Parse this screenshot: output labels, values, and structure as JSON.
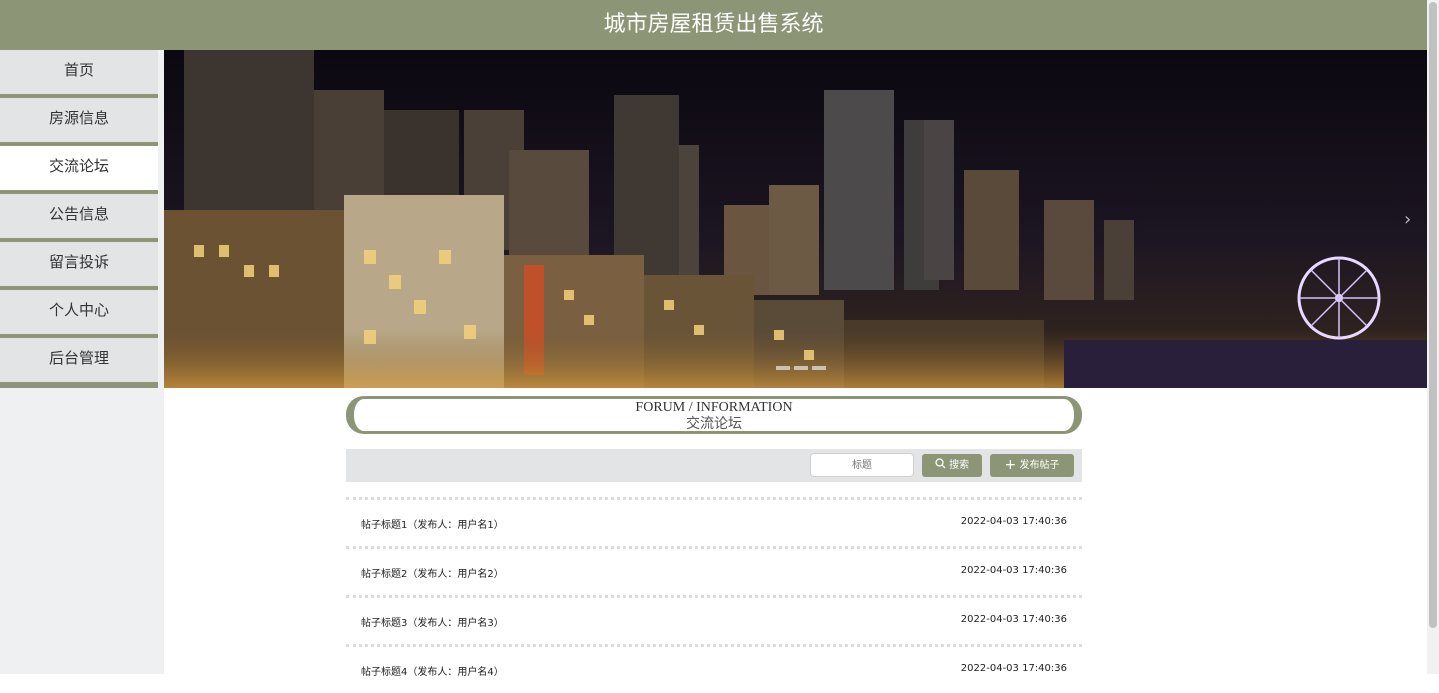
{
  "header": {
    "title": "城市房屋租赁出售系统"
  },
  "sidebar": {
    "items": [
      {
        "label": "首页"
      },
      {
        "label": "房源信息"
      },
      {
        "label": "交流论坛"
      },
      {
        "label": "公告信息"
      },
      {
        "label": "留言投诉"
      },
      {
        "label": "个人中心"
      },
      {
        "label": "后台管理"
      }
    ],
    "active_index": 2
  },
  "main": {
    "title_en": "FORUM / INFORMATION",
    "title_cn": "交流论坛",
    "search": {
      "placeholder": "标题"
    },
    "search_button": "搜索",
    "publish_button": "发布帖子",
    "posts": [
      {
        "title": "帖子标题1（发布人：用户名1）",
        "time": "2022-04-03 17:40:36"
      },
      {
        "title": "帖子标题2（发布人：用户名2）",
        "time": "2022-04-03 17:40:36"
      },
      {
        "title": "帖子标题3（发布人：用户名3）",
        "time": "2022-04-03 17:40:36"
      },
      {
        "title": "帖子标题4（发布人：用户名4）",
        "time": "2022-04-03 17:40:36"
      }
    ]
  },
  "colors": {
    "accent": "#8c9676",
    "sidebar_bg": "#eff0f2",
    "toolbar_bg": "#e3e4e6"
  },
  "icons": {
    "search": "search-icon",
    "publish": "plus-icon",
    "carousel_next": "chevron-right-icon"
  }
}
